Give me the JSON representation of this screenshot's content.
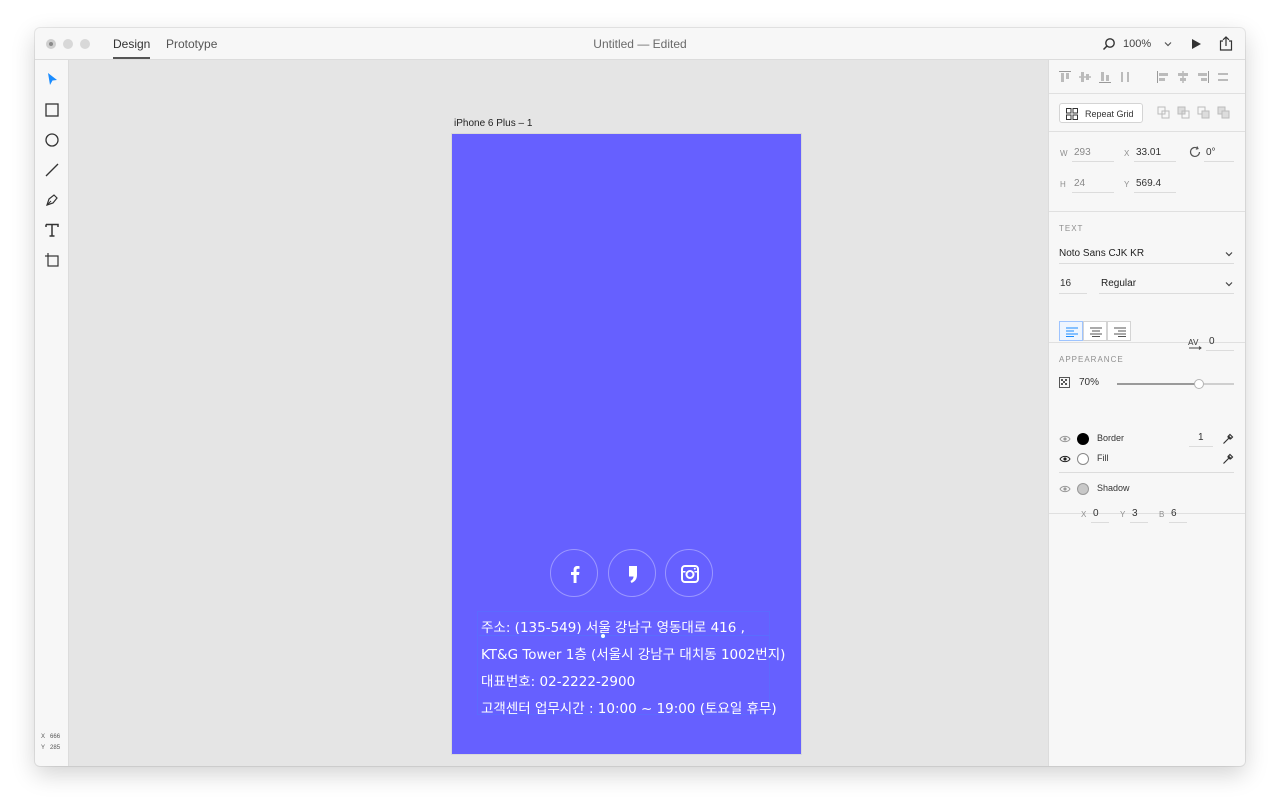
{
  "titlebar": {
    "tabs": [
      "Design",
      "Prototype"
    ],
    "document_title": "Untitled — Edited",
    "zoom": "100%"
  },
  "toolbar": {
    "tools": [
      "select-tool",
      "rectangle-tool",
      "ellipse-tool",
      "line-tool",
      "pen-tool",
      "text-tool",
      "artboard-tool"
    ],
    "cursor_x_label": "X",
    "cursor_x": "666",
    "cursor_y_label": "Y",
    "cursor_y": "285"
  },
  "canvas": {
    "artboard_label": "iPhone 6 Plus – 1",
    "artboard_color": "#6660FF",
    "social_icons": [
      "facebook-icon",
      "quote-icon",
      "instagram-icon"
    ],
    "text_lines": [
      "주소: (135-549) 서울 강남구 영동대로 416 ,",
      "KT&G Tower 1층 (서울시 강남구 대치동 1002번지)",
      "대표번호: 02-2222-2900",
      "고객센터 업무시간 : 10:00 ~ 19:00 (토요일 휴무)"
    ]
  },
  "panel": {
    "repeat_grid_label": "Repeat Grid",
    "w_label": "W",
    "w": "293",
    "x_label": "X",
    "x": "33.01",
    "rotation": "0°",
    "h_label": "H",
    "h": "24",
    "y_label": "Y",
    "y": "569.4",
    "text_section": "TEXT",
    "font_family": "Noto Sans CJK KR",
    "font_size": "16",
    "font_weight": "Regular",
    "char_spacing": "0",
    "appearance_section": "APPEARANCE",
    "opacity": "70%",
    "opacity_value": 70,
    "border_label": "Border",
    "border_width": "1",
    "border_color": "#000000",
    "fill_label": "Fill",
    "shadow_label": "Shadow",
    "shadow_x_label": "X",
    "shadow_x": "0",
    "shadow_y_label": "Y",
    "shadow_y": "3",
    "shadow_b_label": "B",
    "shadow_b": "6"
  }
}
